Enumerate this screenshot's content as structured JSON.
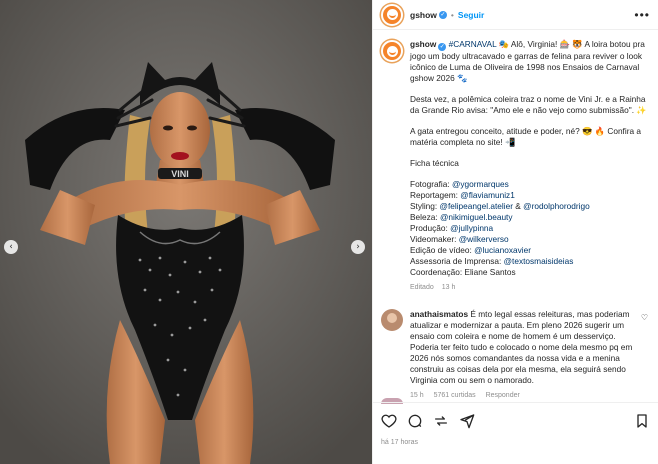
{
  "media": {
    "prev_icon": "chevron-left-icon",
    "next_icon": "chevron-right-icon",
    "choker_text": "VINI"
  },
  "header": {
    "username": "gshow",
    "follow_label": "Seguir",
    "separator": "•",
    "more_icon": "more-horizontal-icon"
  },
  "caption": {
    "username": "gshow",
    "hashtag": "#CARNAVAL",
    "line1": "🎭 Alô, Virginia! 🎰 🐯 A loira botou pra jogo um body ultracavado e garras de felina para reviver o look icônico de Luma de Oliveira de 1998 nos Ensaios de Carnaval gshow 2026 🐾",
    "para2": "Desta vez, a polêmica coleira traz o nome de Vini Jr. e a Rainha da Grande Rio avisa: \"Amo ele e não vejo como submissão\". ✨",
    "para3": "A gata entregou conceito, atitude e poder, né? 😎 🔥 Confira a matéria completa no site! 📲",
    "ficha_title": "Ficha técnica",
    "credits": [
      {
        "label": "Fotografia: ",
        "handle": "@ygormarques"
      },
      {
        "label": "Reportagem: ",
        "handle": "@flaviamuniz1"
      },
      {
        "label": "Styling: ",
        "handle": "@felipeangel.atelier",
        "sep": " & ",
        "handle2": "@rodolphorodrigo"
      },
      {
        "label": "Beleza: ",
        "handle": "@nikimiguel.beauty"
      },
      {
        "label": "Produção: ",
        "handle": "@jullypinna"
      },
      {
        "label": "Videomaker: ",
        "handle": "@wilkerverso"
      },
      {
        "label": "Edição de vídeo: ",
        "handle": "@lucianoxavier"
      },
      {
        "label": "Assessoria de Imprensa: ",
        "handle": "@textosmaisideias"
      },
      {
        "label": "Coordenação: Eliane Santos",
        "handle": ""
      }
    ],
    "meta_edited": "Editado",
    "meta_time": "13 h"
  },
  "comment": {
    "username": "anathaismatos",
    "text": "É mto legal essas releituras, mas poderiam atualizar e modernizar a pauta. Em pleno 2026 sugerir um ensaio com coleira e nome de homem é um desserviço. Poderia ter feito tudo e colocado o nome dela mesmo pq em 2026 nós somos comandantes da nossa vida e a menina construiu as coisas dela por ela mesma, ela seguirá sendo Virginia com ou sem o namorado.",
    "time": "15 h",
    "likes": "5761 curtidas",
    "reply": "Responder"
  },
  "actions": {
    "posted": "há 17 horas"
  }
}
